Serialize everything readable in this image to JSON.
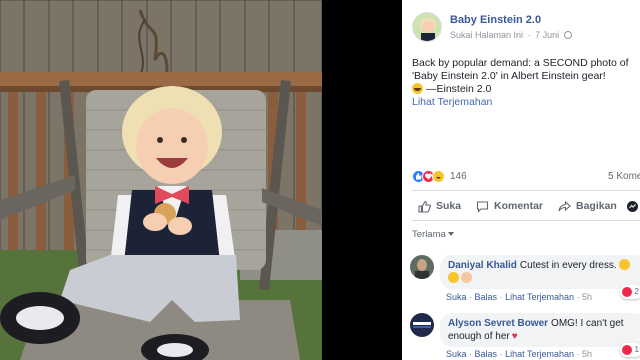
{
  "post": {
    "page_name": "Baby Einstein 2.0",
    "page_meta": "Sukai Halaman Ini",
    "separator": "·",
    "date": "7 Juni",
    "text_lines": [
      "Back by popular demand: a SECOND photo of",
      "'Baby Einstein 2.0' in Albert Einstein gear!",
      "—Einstein 2.0"
    ],
    "see_translation": "Lihat Terjemahan",
    "reaction_count": "146",
    "comment_count": "5 Kome",
    "actions": {
      "like": "Suka",
      "comment": "Komentar",
      "share": "Bagikan"
    },
    "sort_label": "Terlama"
  },
  "comments": [
    {
      "author": "Daniyal Khalid",
      "text": "Cutest in every dress.",
      "actions": {
        "like": "Suka",
        "reply": "Balas",
        "translate": "Lihat Terjemahan",
        "time": "5h",
        "sep": "·"
      },
      "reaction_count": "2"
    },
    {
      "author": "Alyson Sevret Bower",
      "text_line1": "OMG! I can't get",
      "text_line2": "enough of her",
      "actions": {
        "like": "Suka",
        "reply": "Balas",
        "translate": "Lihat Terjemahan",
        "time": "5h",
        "sep": "·"
      },
      "reaction_count": "1"
    }
  ],
  "colors": {
    "link_blue": "#385898",
    "like_blue": "#2f7cf6",
    "love_red": "#f0284a",
    "haha_yellow": "#f7c52b"
  }
}
